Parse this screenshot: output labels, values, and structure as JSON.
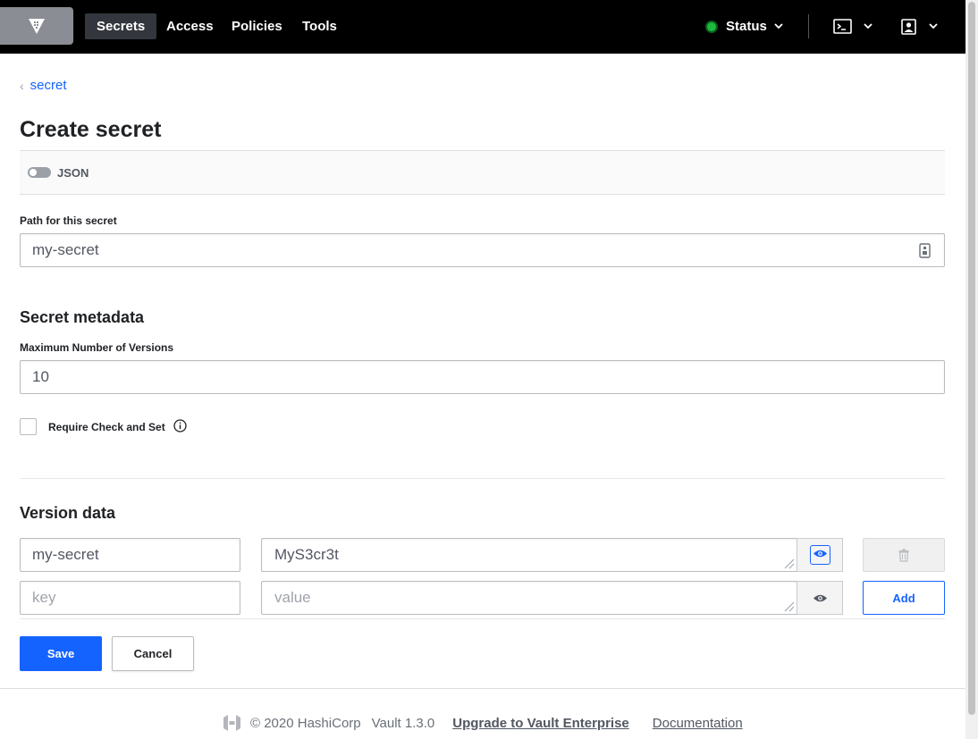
{
  "nav": {
    "items": [
      "Secrets",
      "Access",
      "Policies",
      "Tools"
    ],
    "status_label": "Status"
  },
  "breadcrumb": {
    "label": "secret"
  },
  "page_title": "Create secret",
  "json_toggle": {
    "label": "JSON",
    "on": false
  },
  "path_field": {
    "label": "Path for this secret",
    "value": "my-secret"
  },
  "metadata": {
    "title": "Secret metadata",
    "max_versions_label": "Maximum Number of Versions",
    "max_versions_value": "10",
    "cas_label": "Require Check and Set",
    "cas_checked": false
  },
  "version_data": {
    "title": "Version data",
    "rows": [
      {
        "key": "my-secret",
        "value": "MyS3cr3t"
      },
      {
        "key_placeholder": "key",
        "value_placeholder": "value",
        "button": "Add"
      }
    ]
  },
  "actions": {
    "save": "Save",
    "cancel": "Cancel"
  },
  "footer": {
    "copyright": "© 2020 HashiCorp",
    "version": "Vault 1.3.0",
    "upgrade_link": "Upgrade to Vault Enterprise",
    "docs_link": "Documentation"
  },
  "colors": {
    "accent": "#1563ff",
    "status_ok": "#1cba3c",
    "navbar": "#000000"
  }
}
